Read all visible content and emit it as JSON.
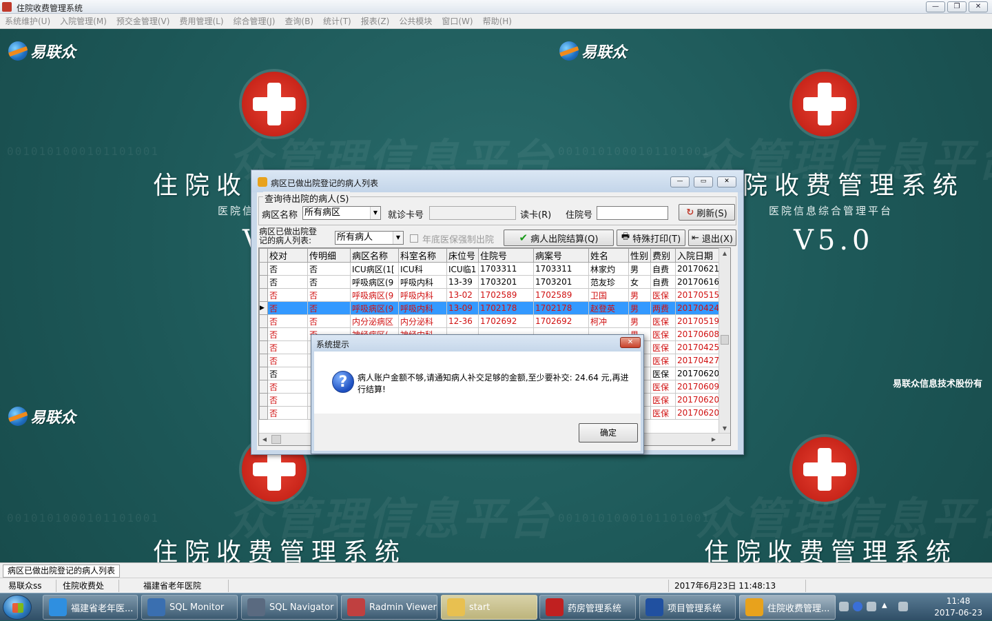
{
  "app": {
    "title": "住院收费管理系统",
    "window_buttons": [
      "—",
      "❐",
      "✕"
    ]
  },
  "menu": [
    "系统维护(U)",
    "入院管理(M)",
    "预交金管理(V)",
    "费用管理(L)",
    "综合管理(J)",
    "查询(B)",
    "统计(T)",
    "报表(Z)",
    "公共模块",
    "窗口(W)",
    "帮助(H)"
  ],
  "desktop": {
    "logo_text": "易联众",
    "system_title": "住院收费管理系统",
    "system_title_partial": "住院收",
    "system_title_right": "院收费管理系统",
    "subtitle": "医院信息综合管理平台",
    "subtitle_partial": "医院信",
    "version": "V5.0",
    "version_partial": "V",
    "company": "易联众信息技术股份有",
    "watermark_binary": "0010101000101101001",
    "watermark_text": "众管理信息平台"
  },
  "list_window": {
    "title": "病区已做出院登记的病人列表",
    "buttons": [
      "—",
      "▭",
      "✕"
    ],
    "query_group": "查询待出院的病人(S)",
    "ward_label": "病区名称",
    "ward_value": "所有病区",
    "card_label": "就诊卡号",
    "card_value": "",
    "read_card_label": "读卡(R)",
    "inpatient_label": "住院号",
    "inpatient_value": "",
    "refresh_label": "刷新(S)",
    "list_label_line1": "病区已做出院登",
    "list_label_line2": "记的病人列表:",
    "patient_filter": "所有病人",
    "year_end_checkbox": "年底医保强制出院",
    "settle_button": "病人出院结算(Q)",
    "print_button": "特殊打印(T)",
    "exit_button": "退出(X)",
    "columns": [
      "校对",
      "传明细",
      "病区名称",
      "科室名称",
      "床位号",
      "住院号",
      "病案号",
      "姓名",
      "性别",
      "费别",
      "入院日期"
    ],
    "rows": [
      {
        "check": "否",
        "detail": "否",
        "ward": "ICU病区(1[",
        "dept": "ICU科",
        "bed": "ICU临1",
        "inpatient": "1703311",
        "record": "1703311",
        "name": "林家灼",
        "sex": "男",
        "fee": "自费",
        "date": "20170621",
        "style": "normal"
      },
      {
        "check": "否",
        "detail": "否",
        "ward": "呼吸病区(9",
        "dept": "呼吸内科",
        "bed": "13-39",
        "inpatient": "1703201",
        "record": "1703201",
        "name": "范友珍",
        "sex": "女",
        "fee": "自费",
        "date": "20170616",
        "style": "normal"
      },
      {
        "check": "否",
        "detail": "否",
        "ward": "呼吸病区(9",
        "dept": "呼吸内科",
        "bed": "13-02",
        "inpatient": "1702589",
        "record": "1702589",
        "name": "卫国",
        "sex": "男",
        "fee": "医保",
        "date": "20170515",
        "style": "red"
      },
      {
        "check": "否",
        "detail": "否",
        "ward": "呼吸病区(9",
        "dept": "呼吸内科",
        "bed": "13-09",
        "inpatient": "1702178",
        "record": "1702178",
        "name": "赵登英",
        "sex": "男",
        "fee": "两费",
        "date": "20170424",
        "style": "sel"
      },
      {
        "check": "否",
        "detail": "否",
        "ward": "内分泌病区",
        "dept": "内分泌科",
        "bed": "12-36",
        "inpatient": "1702692",
        "record": "1702692",
        "name": "柯冲",
        "sex": "男",
        "fee": "医保",
        "date": "20170519",
        "style": "red"
      },
      {
        "check": "否",
        "detail": "否",
        "ward": "神经病区(",
        "dept": "神经内科",
        "bed": "",
        "inpatient": "",
        "record": "",
        "name": "",
        "sex": "男",
        "fee": "医保",
        "date": "20170608",
        "style": "red"
      },
      {
        "check": "否",
        "detail": "",
        "ward": "",
        "dept": "",
        "bed": "",
        "inpatient": "",
        "record": "",
        "name": "",
        "sex": "",
        "fee": "医保",
        "date": "20170425",
        "style": "red"
      },
      {
        "check": "否",
        "detail": "",
        "ward": "",
        "dept": "",
        "bed": "",
        "inpatient": "",
        "record": "",
        "name": "",
        "sex": "",
        "fee": "医保",
        "date": "20170427",
        "style": "red"
      },
      {
        "check": "否",
        "detail": "",
        "ward": "",
        "dept": "",
        "bed": "",
        "inpatient": "",
        "record": "",
        "name": "",
        "sex": "",
        "fee": "医保",
        "date": "20170620",
        "style": "normal"
      },
      {
        "check": "否",
        "detail": "",
        "ward": "",
        "dept": "",
        "bed": "",
        "inpatient": "",
        "record": "",
        "name": "",
        "sex": "",
        "fee": "医保",
        "date": "20170609",
        "style": "red"
      },
      {
        "check": "否",
        "detail": "",
        "ward": "",
        "dept": "",
        "bed": "",
        "inpatient": "",
        "record": "",
        "name": "",
        "sex": "",
        "fee": "医保",
        "date": "20170620",
        "style": "red"
      },
      {
        "check": "否",
        "detail": "",
        "ward": "",
        "dept": "",
        "bed": "",
        "inpatient": "",
        "record": "",
        "name": "",
        "sex": "",
        "fee": "医保",
        "date": "20170620",
        "style": "red"
      }
    ]
  },
  "message_box": {
    "title": "系统提示",
    "close": "✕",
    "icon": "question-icon",
    "icon_glyph": "?",
    "message": "病人账户金额不够,请通知病人补交足够的金额,至少要补交: 24.64 元,再进行结算!",
    "ok_label": "确定"
  },
  "mdi_tab": "病区已做出院登记的病人列表",
  "status": [
    "易联众ss",
    "住院收费处",
    "福建省老年医院",
    "2017年6月23日 11:48:13"
  ],
  "taskbar": {
    "tasks": [
      {
        "label": "福建省老年医...",
        "icon": "ie-icon",
        "color": "#2f8fe0"
      },
      {
        "label": "SQL Monitor",
        "icon": "sql-monitor-icon",
        "color": "#3a6fb0"
      },
      {
        "label": "SQL Navigator",
        "icon": "sql-navigator-icon",
        "color": "#5a6a80"
      },
      {
        "label": "Radmin Viewer",
        "icon": "radmin-icon",
        "color": "#c04040"
      },
      {
        "label": "start",
        "icon": "folder-icon",
        "color": "#e8c050"
      },
      {
        "label": "药房管理系统",
        "icon": "pharmacy-icon",
        "color": "#c02020"
      },
      {
        "label": "项目管理系统",
        "icon": "yuan-icon",
        "color": "#2050a0"
      },
      {
        "label": "住院收费管理...",
        "icon": "hospital-app-icon",
        "color": "#e8a21c"
      }
    ],
    "clock_time": "11:48",
    "clock_date": "2017-06-23"
  }
}
